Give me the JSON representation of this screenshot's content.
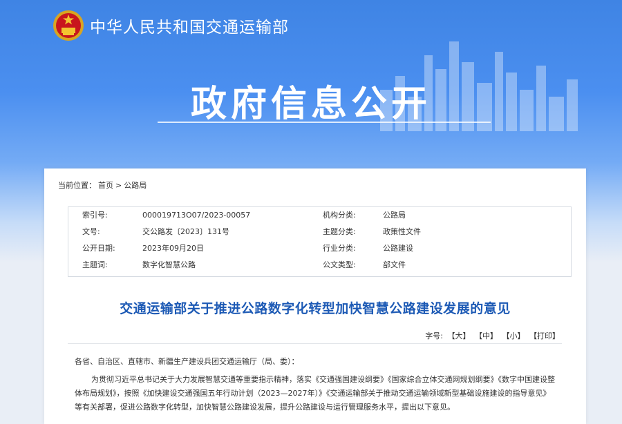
{
  "header": {
    "ministry_name": "中华人民共和国交通运输部",
    "section_title": "政府信息公开"
  },
  "breadcrumb": {
    "label": "当前位置：",
    "home": "首页",
    "separator": ">",
    "current": "公路局"
  },
  "meta": {
    "rows": [
      {
        "k1": "索引号:",
        "v1": "000019713O07/2023-00057",
        "k2": "机构分类:",
        "v2": "公路局"
      },
      {
        "k1": "文号:",
        "v1": "交公路发〔2023〕131号",
        "k2": "主题分类:",
        "v2": "政策性文件"
      },
      {
        "k1": "公开日期:",
        "v1": "2023年09月20日",
        "k2": "行业分类:",
        "v2": "公路建设"
      },
      {
        "k1": "主题词:",
        "v1": "数字化智慧公路",
        "k2": "公文类型:",
        "v2": "部文件"
      }
    ]
  },
  "article": {
    "title": "交通运输部关于推进公路数字化转型加快智慧公路建设发展的意见",
    "addressee": "各省、自治区、直辖市、新疆生产建设兵团交通运输厅（局、委）：",
    "para_line1": "为贯彻习近平总书记关于大力发展智慧交通等重要指示精神，落实《交通强国建设纲要》《国家综合立体交通网规划纲要》《数字中国建设整",
    "para_line2": "体布局规划》，按照《加快建设交通强国五年行动计划（2023—2027年）》《交通运输部关于推动交通运输领域新型基础设施建设的指导意见》",
    "para_line3": "等有关部署，促进公路数字化转型，加快智慧公路建设发展，提升公路建设与运行管理服务水平，提出以下意见。"
  },
  "font_controls": {
    "label": "字号:",
    "large": "【大】",
    "medium": "【中】",
    "small": "【小】",
    "print": "【打印】"
  },
  "colors": {
    "banner_blue": "#4b8ff0",
    "title_blue": "#1d5ab5"
  }
}
